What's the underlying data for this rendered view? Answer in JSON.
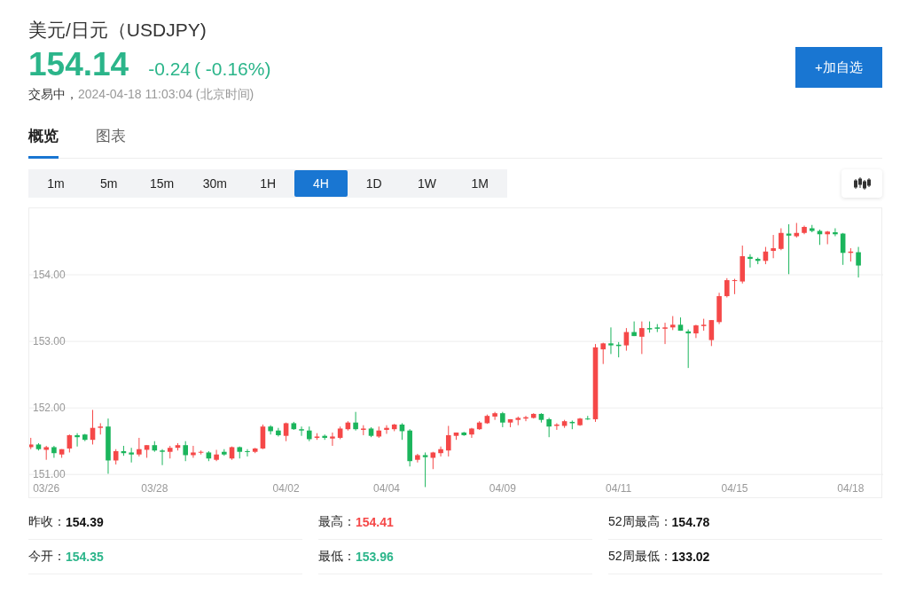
{
  "title": "美元/日元（USDJPY)",
  "quote": {
    "price": "154.14",
    "change": "-0.24",
    "change_pct": "( -0.16%)",
    "color": "#2bb58a"
  },
  "status": {
    "state": "交易中，",
    "timestamp": "2024-04-18 11:03:04 (北京时间)"
  },
  "watchlist_button": "+加自选",
  "tabs": [
    {
      "label": "概览",
      "selected": true
    },
    {
      "label": "图表",
      "selected": false
    }
  ],
  "periods": [
    {
      "label": "1m",
      "selected": false
    },
    {
      "label": "5m",
      "selected": false
    },
    {
      "label": "15m",
      "selected": false
    },
    {
      "label": "30m",
      "selected": false
    },
    {
      "label": "1H",
      "selected": false
    },
    {
      "label": "4H",
      "selected": true
    },
    {
      "label": "1D",
      "selected": false
    },
    {
      "label": "1W",
      "selected": false
    },
    {
      "label": "1M",
      "selected": false
    }
  ],
  "chart": {
    "chart_data": {
      "type": "candlestick",
      "grid": true,
      "ylim": [
        150.67,
        155.0
      ],
      "yticks": [
        {
          "value": 151,
          "label": "151.00"
        },
        {
          "value": 152,
          "label": "152.00"
        },
        {
          "value": 153,
          "label": "153.00"
        },
        {
          "value": 154,
          "label": "154.00"
        }
      ],
      "categories": [
        null,
        null,
        "03/26",
        null,
        null,
        null,
        null,
        null,
        null,
        null,
        null,
        null,
        null,
        null,
        null,
        null,
        "03/28",
        null,
        null,
        null,
        null,
        null,
        null,
        null,
        null,
        null,
        null,
        null,
        null,
        null,
        null,
        null,
        null,
        "04/02",
        null,
        null,
        null,
        null,
        null,
        null,
        null,
        null,
        null,
        null,
        null,
        null,
        "04/04",
        null,
        null,
        null,
        null,
        null,
        null,
        null,
        null,
        null,
        null,
        null,
        null,
        null,
        null,
        "04/09",
        null,
        null,
        null,
        null,
        null,
        null,
        null,
        null,
        null,
        null,
        null,
        null,
        null,
        null,
        "04/11",
        null,
        null,
        null,
        null,
        null,
        null,
        null,
        null,
        null,
        null,
        null,
        null,
        null,
        null,
        "04/15",
        null,
        null,
        null,
        null,
        null,
        null,
        null,
        null,
        null,
        null,
        null,
        null,
        null,
        null,
        "04/18",
        null
      ],
      "ohlc": [
        [
          151.41,
          151.55,
          151.38,
          151.45
        ],
        [
          151.45,
          151.47,
          151.36,
          151.38
        ],
        [
          151.37,
          151.43,
          151.22,
          151.41
        ],
        [
          151.41,
          151.43,
          151.25,
          151.32
        ],
        [
          151.3,
          151.38,
          151.25,
          151.38
        ],
        [
          151.39,
          151.6,
          151.33,
          151.59
        ],
        [
          151.59,
          151.62,
          151.42,
          151.56
        ],
        [
          151.6,
          151.61,
          151.5,
          151.52
        ],
        [
          151.52,
          151.97,
          151.45,
          151.7
        ],
        [
          151.7,
          151.77,
          151.6,
          151.72
        ],
        [
          151.72,
          151.84,
          151.01,
          151.21
        ],
        [
          151.21,
          151.38,
          151.15,
          151.35
        ],
        [
          151.35,
          151.43,
          151.28,
          151.32
        ],
        [
          151.33,
          151.4,
          151.18,
          151.3
        ],
        [
          151.3,
          151.55,
          151.27,
          151.38
        ],
        [
          151.37,
          151.44,
          151.25,
          151.44
        ],
        [
          151.44,
          151.5,
          151.34,
          151.36
        ],
        [
          151.36,
          151.38,
          151.14,
          151.34
        ],
        [
          151.34,
          151.43,
          151.24,
          151.4
        ],
        [
          151.4,
          151.47,
          151.36,
          151.44
        ],
        [
          151.44,
          151.5,
          151.2,
          151.29
        ],
        [
          151.29,
          151.43,
          151.25,
          151.33
        ],
        [
          151.33,
          151.36,
          151.3,
          151.34
        ],
        [
          151.33,
          151.35,
          151.2,
          151.24
        ],
        [
          151.22,
          151.37,
          151.2,
          151.3
        ],
        [
          151.34,
          151.38,
          151.28,
          151.3
        ],
        [
          151.24,
          151.42,
          151.22,
          151.41
        ],
        [
          151.41,
          151.42,
          151.24,
          151.34
        ],
        [
          151.35,
          151.38,
          151.27,
          151.34
        ],
        [
          151.34,
          151.4,
          151.32,
          151.39
        ],
        [
          151.39,
          151.75,
          151.38,
          151.72
        ],
        [
          151.72,
          151.74,
          151.6,
          151.65
        ],
        [
          151.66,
          151.7,
          151.57,
          151.59
        ],
        [
          151.58,
          151.78,
          151.5,
          151.77
        ],
        [
          151.77,
          151.79,
          151.67,
          151.68
        ],
        [
          151.68,
          151.72,
          151.58,
          151.66
        ],
        [
          151.66,
          151.72,
          151.5,
          151.53
        ],
        [
          151.55,
          151.62,
          151.52,
          151.57
        ],
        [
          151.58,
          151.6,
          151.52,
          151.55
        ],
        [
          151.54,
          151.63,
          151.43,
          151.57
        ],
        [
          151.55,
          151.72,
          151.53,
          151.69
        ],
        [
          151.68,
          151.8,
          151.66,
          151.78
        ],
        [
          151.78,
          151.94,
          151.66,
          151.68
        ],
        [
          151.67,
          151.74,
          151.59,
          151.69
        ],
        [
          151.69,
          151.71,
          151.56,
          151.58
        ],
        [
          151.57,
          151.72,
          151.55,
          151.66
        ],
        [
          151.67,
          151.74,
          151.61,
          151.7
        ],
        [
          151.68,
          151.76,
          151.65,
          151.75
        ],
        [
          151.75,
          151.77,
          151.52,
          151.65
        ],
        [
          151.66,
          151.68,
          151.12,
          151.2
        ],
        [
          151.22,
          151.31,
          151.18,
          151.29
        ],
        [
          151.29,
          151.33,
          150.81,
          151.26
        ],
        [
          151.25,
          151.34,
          151.08,
          151.33
        ],
        [
          151.32,
          151.42,
          151.27,
          151.38
        ],
        [
          151.36,
          151.73,
          151.27,
          151.59
        ],
        [
          151.58,
          151.63,
          151.52,
          151.63
        ],
        [
          151.63,
          151.64,
          151.58,
          151.59
        ],
        [
          151.6,
          151.7,
          151.55,
          151.69
        ],
        [
          151.68,
          151.8,
          151.67,
          151.78
        ],
        [
          151.77,
          151.9,
          151.76,
          151.88
        ],
        [
          151.87,
          151.94,
          151.82,
          151.92
        ],
        [
          151.92,
          151.94,
          151.71,
          151.78
        ],
        [
          151.78,
          151.83,
          151.71,
          151.83
        ],
        [
          151.82,
          151.87,
          151.74,
          151.85
        ],
        [
          151.84,
          151.88,
          151.8,
          151.86
        ],
        [
          151.85,
          151.92,
          151.84,
          151.91
        ],
        [
          151.91,
          151.92,
          151.78,
          151.82
        ],
        [
          151.83,
          151.85,
          151.56,
          151.72
        ],
        [
          151.73,
          151.77,
          151.67,
          151.75
        ],
        [
          151.73,
          151.82,
          151.7,
          151.8
        ],
        [
          151.79,
          151.81,
          151.68,
          151.77
        ],
        [
          151.74,
          151.85,
          151.73,
          151.84
        ],
        [
          151.84,
          151.88,
          151.82,
          151.83
        ],
        [
          151.83,
          152.96,
          151.79,
          152.91
        ],
        [
          152.88,
          152.98,
          152.66,
          152.97
        ],
        [
          152.97,
          153.21,
          152.81,
          152.94
        ],
        [
          152.95,
          152.99,
          152.76,
          152.93
        ],
        [
          152.94,
          153.2,
          152.86,
          153.14
        ],
        [
          153.14,
          153.3,
          153.08,
          153.08
        ],
        [
          153.07,
          153.3,
          152.81,
          153.2
        ],
        [
          153.2,
          153.3,
          153.13,
          153.18
        ],
        [
          153.21,
          153.26,
          153.14,
          153.19
        ],
        [
          153.19,
          153.28,
          152.96,
          153.21
        ],
        [
          153.21,
          153.38,
          153.17,
          153.25
        ],
        [
          153.25,
          153.36,
          153.16,
          153.16
        ],
        [
          153.15,
          153.18,
          152.6,
          153.12
        ],
        [
          153.12,
          153.25,
          153.05,
          153.24
        ],
        [
          153.23,
          153.34,
          153.16,
          153.25
        ],
        [
          153.02,
          153.32,
          152.93,
          153.32
        ],
        [
          153.29,
          153.73,
          153.26,
          153.68
        ],
        [
          153.68,
          153.95,
          153.66,
          153.92
        ],
        [
          153.91,
          153.94,
          153.71,
          153.92
        ],
        [
          153.9,
          154.44,
          153.87,
          154.28
        ],
        [
          154.27,
          154.31,
          154.11,
          154.24
        ],
        [
          154.24,
          154.26,
          154.16,
          154.21
        ],
        [
          154.21,
          154.42,
          154.16,
          154.35
        ],
        [
          154.36,
          154.6,
          154.25,
          154.4
        ],
        [
          154.39,
          154.7,
          154.37,
          154.63
        ],
        [
          154.62,
          154.76,
          154.01,
          154.59
        ],
        [
          154.58,
          154.78,
          154.56,
          154.63
        ],
        [
          154.63,
          154.74,
          154.61,
          154.72
        ],
        [
          154.7,
          154.75,
          154.64,
          154.66
        ],
        [
          154.66,
          154.68,
          154.45,
          154.61
        ],
        [
          154.61,
          154.66,
          154.46,
          154.65
        ],
        [
          154.64,
          154.7,
          154.58,
          154.61
        ],
        [
          154.62,
          154.63,
          154.15,
          154.33
        ],
        [
          154.33,
          154.4,
          154.2,
          154.35
        ],
        [
          154.34,
          154.42,
          153.96,
          154.14
        ]
      ]
    }
  },
  "stats": [
    {
      "label": "昨收：",
      "value": "154.39",
      "color": "#111111"
    },
    {
      "label": "最高：",
      "value": "154.41",
      "color": "#f54848"
    },
    {
      "label": "52周最高：",
      "value": "154.78",
      "color": "#111111"
    },
    {
      "label": "今开：",
      "value": "154.35",
      "color": "#2bb58a"
    },
    {
      "label": "最低：",
      "value": "153.96",
      "color": "#2bb58a"
    },
    {
      "label": "52周最低：",
      "value": "133.02",
      "color": "#111111"
    }
  ]
}
